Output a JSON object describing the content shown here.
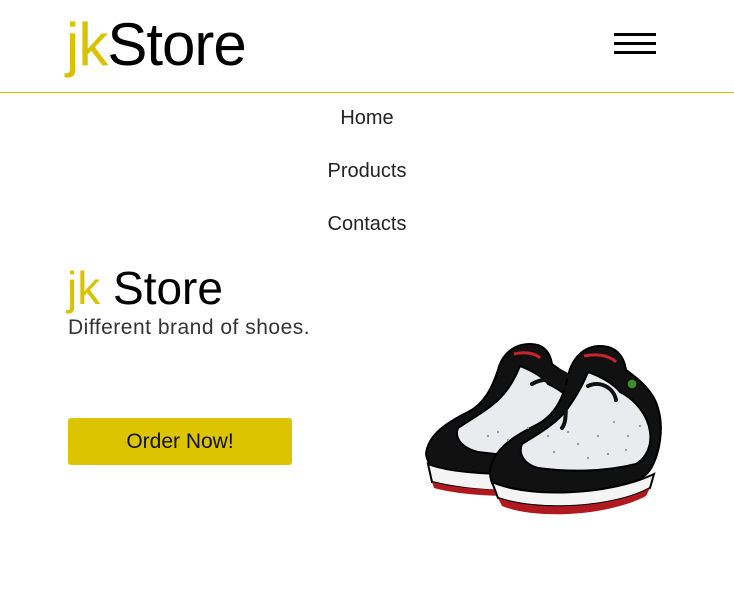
{
  "header": {
    "logo_part1": "jk",
    "logo_part2": "Store",
    "menu_icon": "hamburger-menu-icon"
  },
  "nav": {
    "items": [
      {
        "label": "Home"
      },
      {
        "label": "Products"
      },
      {
        "label": "Contacts"
      }
    ]
  },
  "hero": {
    "title_part1": "jk",
    "title_part2": " Store",
    "subtitle": "Different brand of shoes.",
    "cta_label": "Order Now!",
    "image": "sneakers-illustration"
  },
  "colors": {
    "accent": "#d9c200",
    "button": "#dcc400",
    "text": "#000000"
  }
}
